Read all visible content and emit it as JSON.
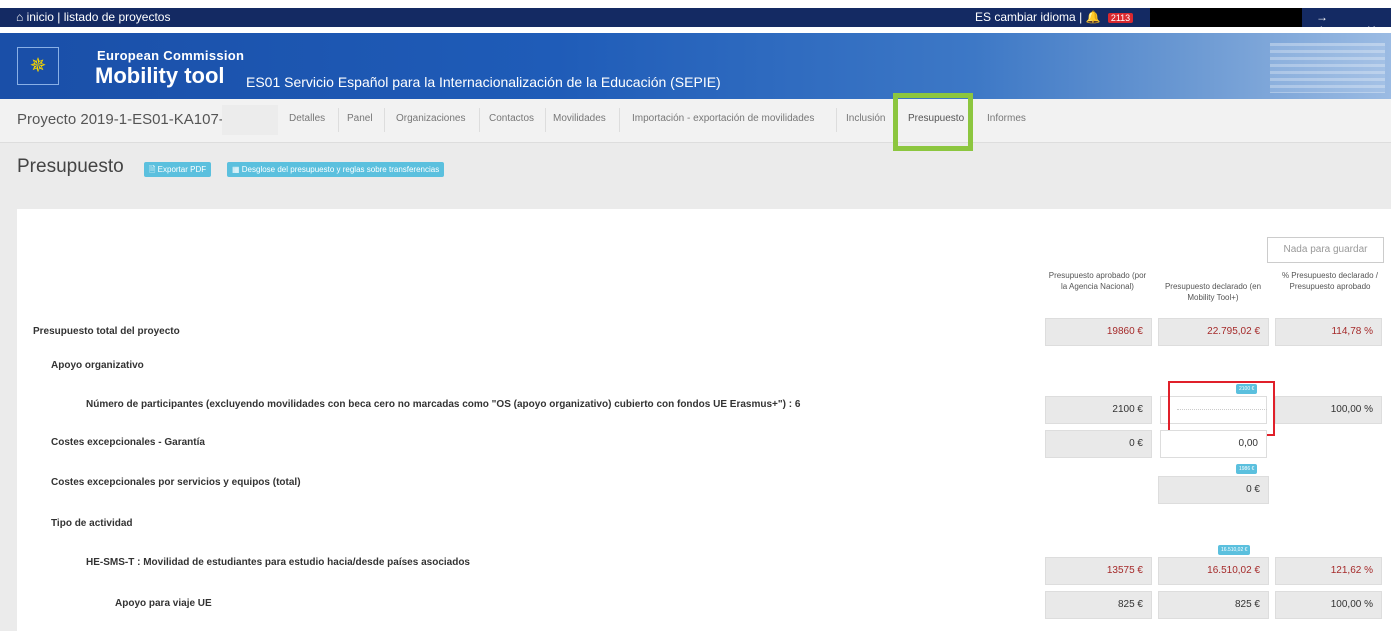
{
  "topbar": {
    "home": "⌂ inicio",
    "list": "listado de proyectos",
    "lang": "ES",
    "change_lang": "cambiar idioma",
    "notifications": "2113",
    "logout": "→ desconexión"
  },
  "banner": {
    "ec": "European Commission",
    "tool": "Mobility tool",
    "org": "ES01 Servicio Español para la Internacionalización de la Educación (SEPIE)"
  },
  "nav": {
    "project": "Proyecto 2019-1-ES01-KA107-",
    "tabs": [
      "Detalles",
      "Panel",
      "Organizaciones",
      "Contactos",
      "Movilidades",
      "Importación - exportación de movilidades",
      "Inclusión",
      "Presupuesto",
      "Informes"
    ]
  },
  "page": {
    "title": "Presupuesto",
    "btn_pdf": "Exportar PDF",
    "btn_breakdown": "Desglose del presupuesto y reglas sobre transferencias",
    "save": "Nada para guardar"
  },
  "columns": {
    "approved": "Presupuesto aprobado (por la Agencia Nacional)",
    "declared": "Presupuesto declarado (en Mobility Tool+)",
    "pct": "% Presupuesto declarado / Presupuesto aprobado"
  },
  "rows": {
    "total": {
      "label": "Presupuesto total del proyecto",
      "approved": "19860 €",
      "declared": "22.795,02 €",
      "pct": "114,78 %"
    },
    "org_support": {
      "label": "Apoyo organizativo"
    },
    "participants": {
      "label": "Número de participantes (excluyendo movilidades con beca cero no marcadas como \"OS (apoyo organizativo) cubierto con fondos UE Erasmus+\") : 6",
      "approved": "2100 €",
      "tag": "2100 €",
      "pct": "100,00 %"
    },
    "guarantee": {
      "label": "Costes excepcionales - Garantía",
      "approved": "0 €",
      "declared": "0,00"
    },
    "exceptional": {
      "label": "Costes excepcionales por servicios y equipos (total)",
      "tag": "1986 €",
      "declared": "0 €"
    },
    "activity_type": {
      "label": "Tipo de actividad"
    },
    "hesms": {
      "label": "HE-SMS-T : Movilidad de estudiantes para estudio hacia/desde países asociados",
      "tag": "16.510,02 €",
      "approved": "13575 €",
      "declared": "16.510,02 €",
      "pct": "121,62 %"
    },
    "travel": {
      "label": "Apoyo para viaje UE",
      "approved": "825 €",
      "declared": "825 €",
      "pct": "100,00 %"
    }
  }
}
